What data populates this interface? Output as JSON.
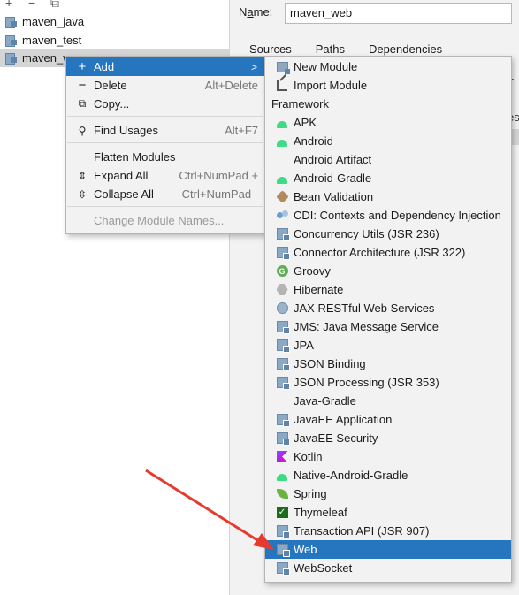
{
  "tree": {
    "toolbar": {
      "add_glyph": "+",
      "remove_glyph": "−",
      "copy_glyph": "⧉"
    },
    "items": [
      {
        "label": "maven_java"
      },
      {
        "label": "maven_test"
      },
      {
        "label": "maven_w"
      }
    ]
  },
  "panel": {
    "name_label_prefix": "N",
    "name_label_underlined": "a",
    "name_label_suffix": "me:",
    "name_value": "maven_web",
    "tabs": [
      "Sources",
      "Paths",
      "Dependencies"
    ],
    "fragment_1": "tir",
    "fragment_2": "es"
  },
  "menu": {
    "items": [
      {
        "label": "Add",
        "shortcut": "",
        "icon": "plus-icon"
      },
      {
        "label": "Delete",
        "shortcut": "Alt+Delete",
        "icon": "minus-icon"
      },
      {
        "label": "Copy...",
        "shortcut": "",
        "icon": "copy-icon"
      },
      {
        "label": "Find Usages",
        "shortcut": "Alt+F7",
        "icon": "search-icon"
      },
      {
        "label": "Flatten Modules",
        "shortcut": "",
        "icon": ""
      },
      {
        "label": "Expand All",
        "shortcut": "Ctrl+NumPad +",
        "icon": "expand-all-icon"
      },
      {
        "label": "Collapse All",
        "shortcut": "Ctrl+NumPad -",
        "icon": "collapse-all-icon"
      },
      {
        "label": "Change Module Names...",
        "shortcut": "",
        "icon": ""
      }
    ]
  },
  "submenu": {
    "new_module": "New Module",
    "import_module": "Import Module",
    "framework_header": "Framework",
    "frameworks": [
      {
        "label": "APK",
        "icon": "android-icon"
      },
      {
        "label": "Android",
        "icon": "android-icon"
      },
      {
        "label": "Android Artifact",
        "icon": ""
      },
      {
        "label": "Android-Gradle",
        "icon": "android-icon"
      },
      {
        "label": "Bean Validation",
        "icon": "bean-validation-icon"
      },
      {
        "label": "CDI: Contexts and Dependency Injection",
        "icon": "cdi-icon"
      },
      {
        "label": "Concurrency Utils (JSR 236)",
        "icon": "javaee-icon"
      },
      {
        "label": "Connector Architecture (JSR 322)",
        "icon": "javaee-icon"
      },
      {
        "label": "Groovy",
        "icon": "groovy-icon"
      },
      {
        "label": "Hibernate",
        "icon": "hibernate-icon"
      },
      {
        "label": "JAX RESTful Web Services",
        "icon": "jaxrs-icon"
      },
      {
        "label": "JMS: Java Message Service",
        "icon": "javaee-icon"
      },
      {
        "label": "JPA",
        "icon": "jpa-icon"
      },
      {
        "label": "JSON Binding",
        "icon": "javaee-icon"
      },
      {
        "label": "JSON Processing (JSR 353)",
        "icon": "javaee-icon"
      },
      {
        "label": "Java-Gradle",
        "icon": ""
      },
      {
        "label": "JavaEE Application",
        "icon": "javaee-icon"
      },
      {
        "label": "JavaEE Security",
        "icon": "javaee-icon"
      },
      {
        "label": "Kotlin",
        "icon": "kotlin-icon"
      },
      {
        "label": "Native-Android-Gradle",
        "icon": "android-icon"
      },
      {
        "label": "Spring",
        "icon": "spring-icon"
      },
      {
        "label": "Thymeleaf",
        "icon": "thymeleaf-icon"
      },
      {
        "label": "Transaction API (JSR 907)",
        "icon": "javaee-icon"
      },
      {
        "label": "Web",
        "icon": "web-icon"
      },
      {
        "label": "WebSocket",
        "icon": "javaee-icon"
      }
    ]
  },
  "colors": {
    "highlight": "#2675bf",
    "menu_bg": "#f2f2f2",
    "annotation_arrow": "#e63a2e"
  }
}
